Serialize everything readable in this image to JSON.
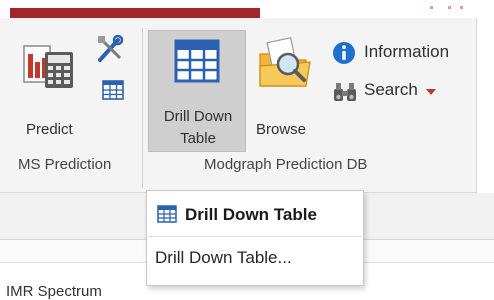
{
  "ribbon": {
    "predict": {
      "label": "Predict",
      "icon": "predict-calculator-icon"
    },
    "tools": {
      "icon": "tools-icon"
    },
    "table_small": {
      "icon": "table-icon"
    },
    "group_ms": "MS Prediction",
    "drill_down": {
      "line1": "Drill Down",
      "line2": "Table",
      "icon": "table-icon"
    },
    "browse": {
      "label": "Browse",
      "icon": "folder-search-icon"
    },
    "information": {
      "label": "Information",
      "icon": "info-icon"
    },
    "search": {
      "label": "Search",
      "icon": "binoculars-icon",
      "arrow": "dropdown-arrow-icon"
    },
    "group_modgraph": "Modgraph Prediction DB"
  },
  "dropdown": {
    "header": "Drill Down Table",
    "item": "Drill Down Table..."
  },
  "partial_text": "IMR Spectrum",
  "colors": {
    "accent_red": "#a4262c",
    "info_blue": "#1e6fd0",
    "table_blue": "#2a62b0",
    "selected_bg": "#cfcfcf"
  }
}
